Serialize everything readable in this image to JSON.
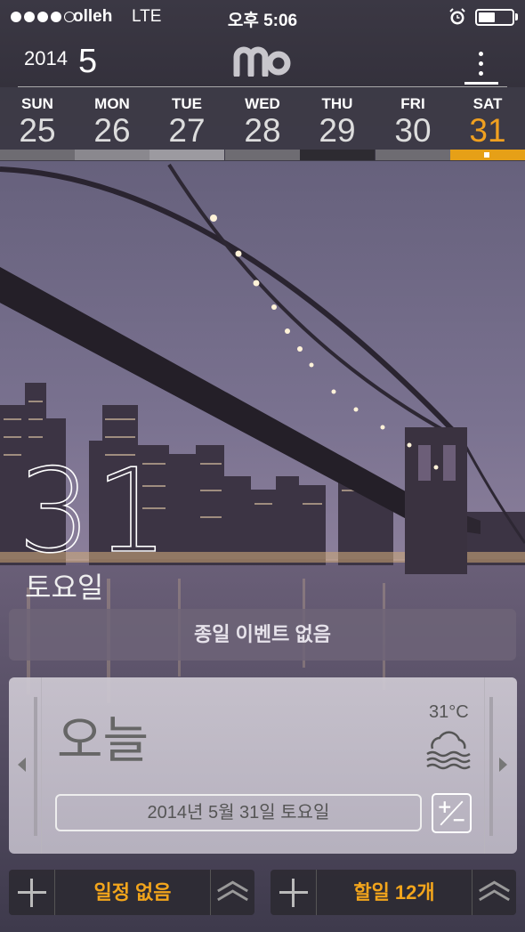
{
  "status_bar": {
    "carrier": "olleh",
    "network": "LTE",
    "time": "오후 5:06",
    "signal_bars_filled": 4,
    "signal_bars_total": 5
  },
  "header": {
    "year": "2014",
    "month": "5",
    "logo_icon": "mo-logo-icon",
    "menu_icon": "more-vertical-icon"
  },
  "week": {
    "days": [
      {
        "name": "SUN",
        "date": "25",
        "color": "#6e6c72"
      },
      {
        "name": "MON",
        "date": "26",
        "color": "#8a888e"
      },
      {
        "name": "TUE",
        "date": "27",
        "color": "#9c9aa0"
      },
      {
        "name": "WED",
        "date": "28",
        "color": "#6e6c72"
      },
      {
        "name": "THU",
        "date": "29",
        "color": "#2d2b31"
      },
      {
        "name": "FRI",
        "date": "30",
        "color": "#6e6c72"
      },
      {
        "name": "SAT",
        "date": "31",
        "color": "#e6a017"
      }
    ],
    "selected_index": 6,
    "accent_color": "#f0a020"
  },
  "hero": {
    "day_number": "31",
    "weekday": "토요일"
  },
  "allday": {
    "text": "종일 이벤트 없음"
  },
  "today_card": {
    "label": "오늘",
    "temperature": "31°C",
    "weather_icon": "fog-icon",
    "full_date": "2014년 5월 31일 토요일",
    "plusminus_icon": "plus-minus-icon"
  },
  "bottom": {
    "schedule_label": "일정 없음",
    "todo_label": "할일 12개",
    "accent": "#f2a51c"
  }
}
